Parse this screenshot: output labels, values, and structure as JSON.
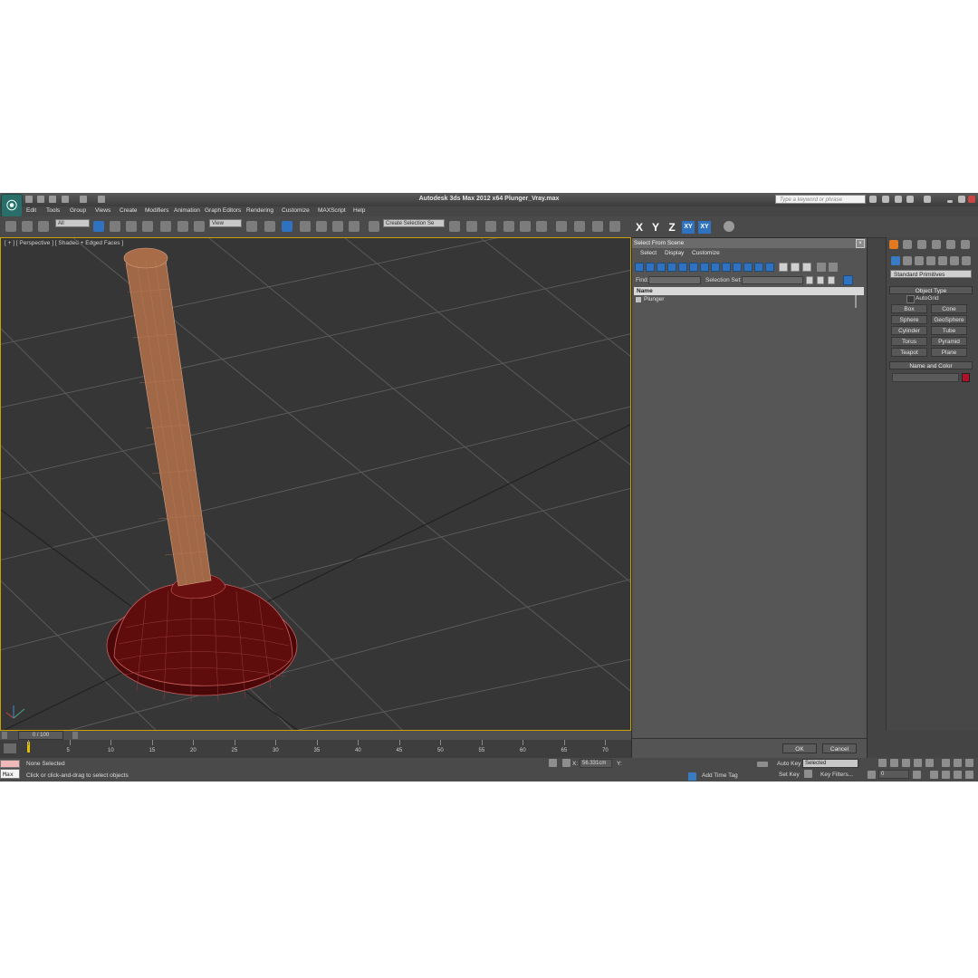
{
  "app": {
    "title": "Autodesk 3ds Max  2012 x64     Plunger_Vray.max",
    "logo": "3ds-max-logo-icon",
    "search_placeholder": "Type a keyword or phrase"
  },
  "menu": [
    "Edit",
    "Tools",
    "Group",
    "Views",
    "Create",
    "Modifiers",
    "Animation",
    "Graph Editors",
    "Rendering",
    "Customize",
    "MAXScript",
    "Help"
  ],
  "toolbar": {
    "filter_value": "All",
    "view_value": "View",
    "selection_set_placeholder": "Create Selection Se",
    "axes": [
      "X",
      "Y",
      "Z",
      "XY",
      "XY"
    ]
  },
  "viewport": {
    "label": "[ + ] [ Perspective ] [ Shaded + Edged Faces ]",
    "object_handle_color": "#a06846",
    "object_cup_color": "#6e1010"
  },
  "dialog": {
    "title": "Select From Scene",
    "menu": [
      "Select",
      "Display",
      "Customize"
    ],
    "find_label": "Find:",
    "selection_set_label": "Selection Set:",
    "column_header": "Name",
    "items": [
      "Plunger"
    ],
    "ok_label": "OK",
    "cancel_label": "Cancel"
  },
  "command_panel": {
    "category": "Standard Primitives",
    "object_type_header": "Object Type",
    "autogrid_label": "AutoGrid",
    "buttons": [
      "Box",
      "Cone",
      "Sphere",
      "GeoSphere",
      "Cylinder",
      "Tube",
      "Torus",
      "Pyramid",
      "Teapot",
      "Plane"
    ],
    "name_color_header": "Name and Color",
    "object_color": "#b0102a"
  },
  "timeline": {
    "frame_display": "0 / 100",
    "ticks": [
      "0",
      "5",
      "10",
      "15",
      "20",
      "25",
      "30",
      "35",
      "40",
      "45",
      "50",
      "55",
      "60",
      "65",
      "70"
    ]
  },
  "status": {
    "selection": "None Selected",
    "prompt": "Click or click-and-drag to select objects",
    "maxscript_label": "Max",
    "x_label": "X:",
    "x_value": "56.331cm",
    "y_label": "Y:",
    "add_time_tag": "Add Time Tag",
    "auto_key": "Auto Key",
    "set_key": "Set Key",
    "key_filters": "Key Filters...",
    "selected_value": "Selected",
    "frame_value": "0"
  }
}
